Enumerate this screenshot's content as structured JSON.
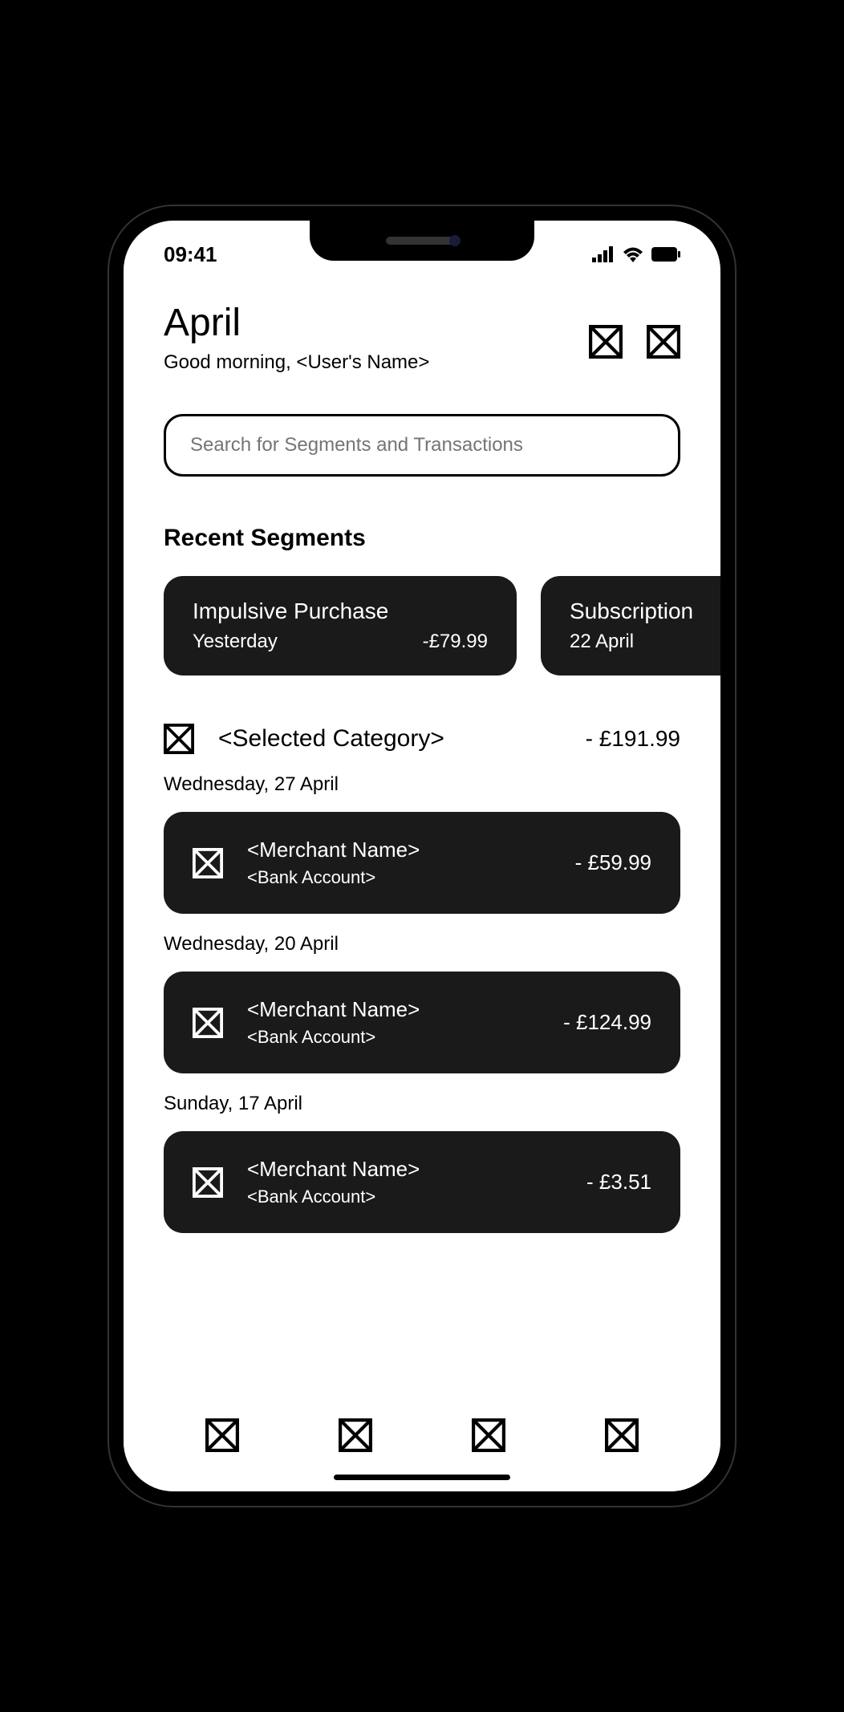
{
  "status": {
    "time": "09:41"
  },
  "header": {
    "month": "April",
    "greeting": "Good morning, <User's Name>"
  },
  "search": {
    "placeholder": "Search for Segments and Transactions"
  },
  "segments": {
    "title": "Recent Segments",
    "items": [
      {
        "title": "Impulsive Purchase",
        "date": "Yesterday",
        "amount": "-£79.99"
      },
      {
        "title": "Subscription",
        "date": "22 April",
        "amount": ""
      }
    ]
  },
  "category": {
    "name": "<Selected Category>",
    "amount": "- £191.99"
  },
  "transactions": [
    {
      "date": "Wednesday, 27 April",
      "merchant": "<Merchant Name>",
      "account": "<Bank Account>",
      "amount": "- £59.99"
    },
    {
      "date": "Wednesday, 20 April",
      "merchant": "<Merchant Name>",
      "account": "<Bank Account>",
      "amount": "- £124.99"
    },
    {
      "date": "Sunday, 17 April",
      "merchant": "<Merchant Name>",
      "account": "<Bank Account>",
      "amount": "- £3.51"
    }
  ]
}
